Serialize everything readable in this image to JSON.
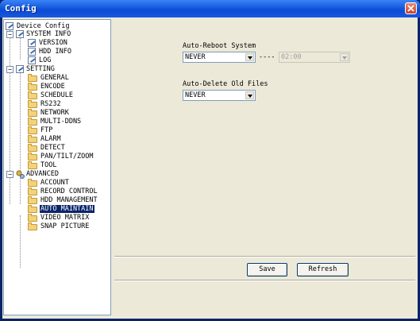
{
  "window": {
    "title": "Config"
  },
  "tree": {
    "root": "Device Config",
    "system_info": {
      "label": "SYSTEM INFO",
      "children": [
        "VERSION",
        "HDD INFO",
        "LOG"
      ]
    },
    "setting": {
      "label": "SETTING",
      "children": [
        "GENERAL",
        "ENCODE",
        "SCHEDULE",
        "RS232",
        "NETWORK",
        "MULTI-DDNS",
        "FTP",
        "ALARM",
        "DETECT",
        "PAN/TILT/ZOOM",
        "TOOL"
      ]
    },
    "advanced": {
      "label": "ADVANCED",
      "children": [
        "ACCOUNT",
        "RECORD CONTROL",
        "HDD MANAGEMENT",
        "AUTO MAINTAIN",
        "VIDEO MATRIX",
        "SNAP PICTURE"
      ]
    },
    "selected": "AUTO MAINTAIN"
  },
  "panel": {
    "reboot_label": "Auto-Reboot System",
    "reboot_value": "NEVER",
    "reboot_dash": "----",
    "reboot_time": "02:00",
    "delete_label": "Auto-Delete Old Files",
    "delete_value": "NEVER",
    "save_label": "Save",
    "refresh_label": "Refresh"
  }
}
